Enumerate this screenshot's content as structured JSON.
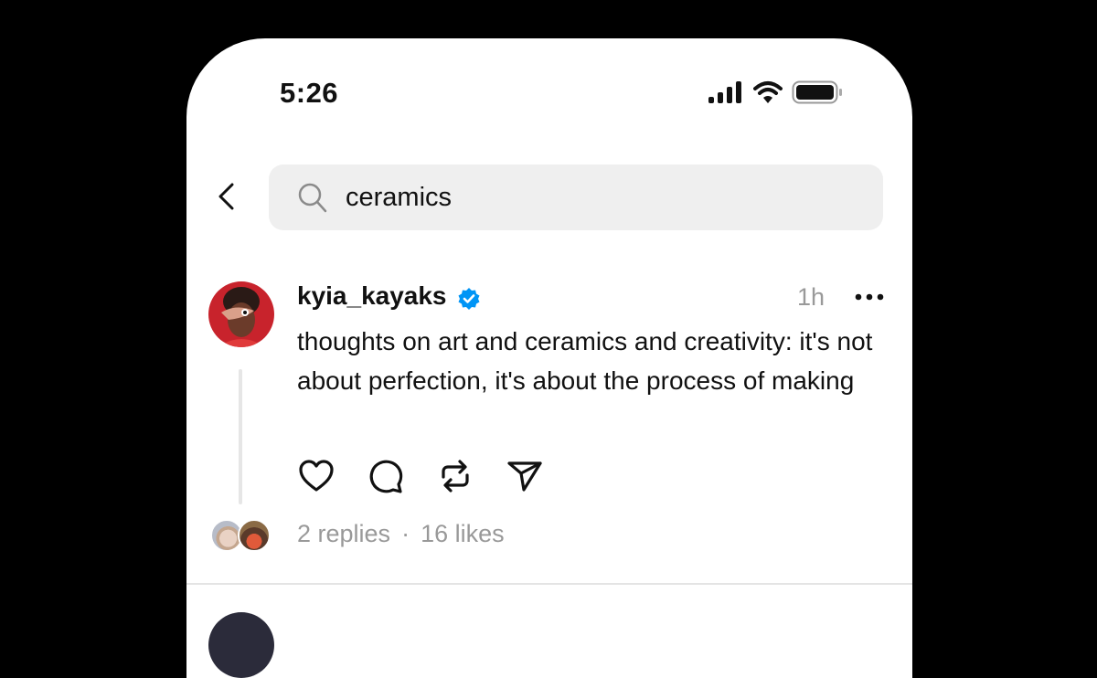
{
  "status_bar": {
    "time": "5:26",
    "icons": [
      "cellular-signal-icon",
      "wifi-icon",
      "battery-icon"
    ]
  },
  "search": {
    "back_icon": "chevron-left-icon",
    "search_icon": "search-icon",
    "query": "ceramics"
  },
  "post": {
    "username": "kyia_kayaks",
    "verified": true,
    "time": "1h",
    "more_icon": "more-horizontal-icon",
    "text": "thoughts on art and ceramics and creativity: it's not about perfection, it's about the process of making",
    "actions": [
      {
        "name": "like",
        "icon": "heart-icon"
      },
      {
        "name": "reply",
        "icon": "comment-icon"
      },
      {
        "name": "repost",
        "icon": "repost-icon"
      },
      {
        "name": "share",
        "icon": "send-icon"
      }
    ],
    "replies": "2 replies",
    "separator": "·",
    "likes": "16 likes"
  },
  "colors": {
    "verified_blue": "#0095f6",
    "secondary_text": "#999999",
    "search_bg": "#efefef"
  }
}
